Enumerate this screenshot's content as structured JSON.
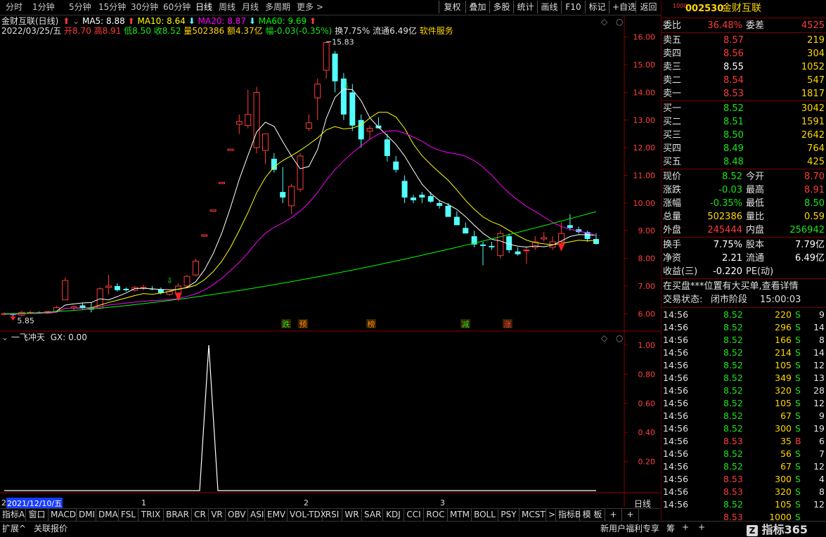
{
  "periods": [
    "分时",
    "1分钟",
    "5分钟",
    "15分钟",
    "30分钟",
    "60分钟",
    "日线",
    "周线",
    "月线",
    "多周期",
    "更多 >"
  ],
  "active_period": "日线",
  "toolbar": [
    "复权",
    "叠加",
    "多股",
    "统计",
    "画线",
    "F10",
    "标记",
    "+自选",
    "返回"
  ],
  "chart": {
    "name": "金财互联(日线)",
    "ma_legend": [
      {
        "label": "MA5: 8.88",
        "color": "#ffffff"
      },
      {
        "label": "MA10: 8.64",
        "color": "#ffff00"
      },
      {
        "label": "MA20: 8.87",
        "color": "#ff00ff"
      },
      {
        "label": "MA60: 9.69",
        "color": "#00ff00"
      }
    ],
    "info": {
      "date": "2022/03/25/五",
      "open": "开8.70",
      "high": "高8.91",
      "low": "低8.50",
      "close": "收8.52",
      "vol": "量502386",
      "amount": "额4.37亿",
      "change": "幅-0.03(-0.35%)",
      "turnover": "换7.75%",
      "float": "流通6.49亿",
      "sector": "软件服务"
    },
    "yticks": [
      "16.00",
      "15.00",
      "14.00",
      "13.00",
      "12.00",
      "11.00",
      "10.00",
      "9.00",
      "8.00",
      "7.00",
      "6.00"
    ],
    "high_label": "15.83",
    "low_label": "5.85",
    "markers": [
      {
        "text": "跌",
        "color": "#19e619"
      },
      {
        "text": "预",
        "color": "#ff8c00"
      },
      {
        "text": "榜",
        "color": "#ff8c00"
      },
      {
        "text": "减",
        "color": "#19e619"
      },
      {
        "text": "涨",
        "color": "#ff3b3b"
      }
    ],
    "indicator_name": "一飞冲天",
    "indicator_value": "GX: 0.00",
    "ind_ticks": [
      "1.00",
      "0.80",
      "0.60",
      "0.40",
      "0.20"
    ],
    "xaxis": {
      "date": "2021/12/10/五",
      "m1": "1",
      "m2": "2",
      "m3": "3",
      "period": "日线",
      "lead": "2"
    }
  },
  "chart_data": {
    "type": "candlestick",
    "price_axis": [
      5.5,
      16.5
    ],
    "candles": [
      [
        6.0,
        6.05,
        5.95,
        6.0
      ],
      [
        6.0,
        6.02,
        5.85,
        5.95
      ],
      [
        5.95,
        6.1,
        5.9,
        6.05
      ],
      [
        6.05,
        6.1,
        6.0,
        6.05
      ],
      [
        6.05,
        6.08,
        6.0,
        6.02
      ],
      [
        6.02,
        6.1,
        6.0,
        6.08
      ],
      [
        6.08,
        6.3,
        6.05,
        6.22
      ],
      [
        6.5,
        7.3,
        6.5,
        7.2
      ],
      [
        6.2,
        6.3,
        6.1,
        6.25
      ],
      [
        6.3,
        6.4,
        6.15,
        6.2
      ],
      [
        6.2,
        6.4,
        6.05,
        6.15
      ],
      [
        6.2,
        6.95,
        6.15,
        6.9
      ],
      [
        6.95,
        7.4,
        6.7,
        7.0
      ],
      [
        7.0,
        7.1,
        6.8,
        6.85
      ],
      [
        6.9,
        6.95,
        6.8,
        6.85
      ],
      [
        6.85,
        7.0,
        6.8,
        6.95
      ],
      [
        6.95,
        7.05,
        6.85,
        6.95
      ],
      [
        6.9,
        7.0,
        6.85,
        6.88
      ],
      [
        6.88,
        6.95,
        6.7,
        6.75
      ],
      [
        6.7,
        6.85,
        6.65,
        6.8
      ],
      [
        6.75,
        7.1,
        6.7,
        7.0
      ],
      [
        7.0,
        7.4,
        6.95,
        7.35
      ],
      [
        7.4,
        8.0,
        7.35,
        7.9
      ],
      [
        8.8,
        8.85,
        8.8,
        8.85
      ],
      [
        9.7,
        9.75,
        9.7,
        9.75
      ],
      [
        10.7,
        10.75,
        10.7,
        10.75
      ],
      [
        11.9,
        11.95,
        11.9,
        11.95
      ],
      [
        12.85,
        13.2,
        12.5,
        12.95
      ],
      [
        12.8,
        14.1,
        12.7,
        13.2
      ],
      [
        12.0,
        14.2,
        11.8,
        14.0
      ],
      [
        11.9,
        12.5,
        11.4,
        12.5
      ],
      [
        11.6,
        11.8,
        11.1,
        11.2
      ],
      [
        10.4,
        11.3,
        10.0,
        10.2
      ],
      [
        9.9,
        10.7,
        9.6,
        10.6
      ],
      [
        10.5,
        11.8,
        10.4,
        11.7
      ],
      [
        12.7,
        13.2,
        12.6,
        12.9
      ],
      [
        13.8,
        14.5,
        13.0,
        14.3
      ],
      [
        14.8,
        15.83,
        14.5,
        15.8
      ],
      [
        15.4,
        15.5,
        14.0,
        14.4
      ],
      [
        14.5,
        14.7,
        13.0,
        13.2
      ],
      [
        14.0,
        14.3,
        12.6,
        12.8
      ],
      [
        13.0,
        13.2,
        12.0,
        12.3
      ],
      [
        12.6,
        12.8,
        12.3,
        12.7
      ],
      [
        12.8,
        13.1,
        12.7,
        12.7
      ],
      [
        12.3,
        12.5,
        11.5,
        11.7
      ],
      [
        11.5,
        11.7,
        11.1,
        11.2
      ],
      [
        10.8,
        11.0,
        10.0,
        10.2
      ],
      [
        10.2,
        10.3,
        10.0,
        10.1
      ],
      [
        10.3,
        10.4,
        10.0,
        10.2
      ],
      [
        10.25,
        10.4,
        10.0,
        10.05
      ],
      [
        10.0,
        10.1,
        9.8,
        9.9
      ],
      [
        9.9,
        10.0,
        9.6,
        9.5
      ],
      [
        9.5,
        9.7,
        9.2,
        9.2
      ],
      [
        9.1,
        9.3,
        8.9,
        8.9
      ],
      [
        8.8,
        9.0,
        8.4,
        8.5
      ],
      [
        8.5,
        8.6,
        7.75,
        8.45
      ],
      [
        8.45,
        8.6,
        8.3,
        8.4
      ],
      [
        8.1,
        9.0,
        8.0,
        8.9
      ],
      [
        8.8,
        8.9,
        8.2,
        8.3
      ],
      [
        8.25,
        8.4,
        8.1,
        8.15
      ],
      [
        8.3,
        8.4,
        7.8,
        8.3
      ],
      [
        8.4,
        8.8,
        8.3,
        8.6
      ],
      [
        8.7,
        8.95,
        8.6,
        8.75
      ],
      [
        8.4,
        8.8,
        8.3,
        8.6
      ],
      [
        8.6,
        9.3,
        8.5,
        8.9
      ],
      [
        9.2,
        9.6,
        9.0,
        9.1
      ],
      [
        9.05,
        9.15,
        8.9,
        8.95
      ],
      [
        8.95,
        9.0,
        8.6,
        8.7
      ],
      [
        8.7,
        8.91,
        8.5,
        8.52
      ]
    ],
    "signal_index": 20
  },
  "right": {
    "code": "002530",
    "stock_name": "金财互联",
    "weibi": {
      "label": "委比",
      "value": "36.48%",
      "label2": "委差",
      "value2": "4525"
    },
    "asks": [
      {
        "label": "卖五",
        "price": "8.57",
        "vol": "219"
      },
      {
        "label": "卖四",
        "price": "8.56",
        "vol": "304"
      },
      {
        "label": "卖三",
        "price": "8.55",
        "vol": "1052"
      },
      {
        "label": "卖二",
        "price": "8.54",
        "vol": "547"
      },
      {
        "label": "卖一",
        "price": "8.53",
        "vol": "1817"
      }
    ],
    "bids": [
      {
        "label": "买一",
        "price": "8.52",
        "vol": "3042"
      },
      {
        "label": "买二",
        "price": "8.51",
        "vol": "1591"
      },
      {
        "label": "买三",
        "price": "8.50",
        "vol": "2642"
      },
      {
        "label": "买四",
        "price": "8.49",
        "vol": "764"
      },
      {
        "label": "买五",
        "price": "8.48",
        "vol": "425"
      }
    ],
    "quote": [
      {
        "l1": "现价",
        "v1": "8.52",
        "c1": "green",
        "l2": "今开",
        "v2": "8.70",
        "c2": "red"
      },
      {
        "l1": "涨跌",
        "v1": "-0.03",
        "c1": "green",
        "l2": "最高",
        "v2": "8.91",
        "c2": "red"
      },
      {
        "l1": "涨幅",
        "v1": "-0.35%",
        "c1": "green",
        "l2": "最低",
        "v2": "8.50",
        "c2": "green"
      },
      {
        "l1": "总量",
        "v1": "502386",
        "c1": "yellow",
        "l2": "量比",
        "v2": "0.59",
        "c2": "yellow"
      },
      {
        "l1": "外盘",
        "v1": "245444",
        "c1": "red",
        "l2": "内盘",
        "v2": "256942",
        "c2": "green"
      }
    ],
    "quote2": [
      {
        "l1": "换手",
        "v1": "7.75%",
        "l2": "股本",
        "v2": "7.79亿"
      },
      {
        "l1": "净资",
        "v1": "2.21",
        "l2": "流通",
        "v2": "6.49亿"
      },
      {
        "l1": "收益(三)",
        "v1": "-0.220",
        "l2": "PE(动)",
        "v2": ""
      }
    ],
    "notice": "在买盘***位置有大买单,查看详情",
    "status_label": "交易状态:",
    "status_value": "闭市阶段",
    "status_time": "15:00:03",
    "ticks": [
      {
        "t": "14:56",
        "p": "8.52",
        "v": "220",
        "s": "S",
        "n": "9"
      },
      {
        "t": "14:56",
        "p": "8.52",
        "v": "296",
        "s": "S",
        "n": "14"
      },
      {
        "t": "14:56",
        "p": "8.52",
        "v": "166",
        "s": "S",
        "n": "8"
      },
      {
        "t": "14:56",
        "p": "8.52",
        "v": "214",
        "s": "S",
        "n": "14"
      },
      {
        "t": "14:56",
        "p": "8.52",
        "v": "105",
        "s": "S",
        "n": "12"
      },
      {
        "t": "14:56",
        "p": "8.52",
        "v": "349",
        "s": "S",
        "n": "13"
      },
      {
        "t": "14:56",
        "p": "8.52",
        "v": "320",
        "s": "S",
        "n": "28"
      },
      {
        "t": "14:56",
        "p": "8.52",
        "v": "105",
        "s": "S",
        "n": "12"
      },
      {
        "t": "14:56",
        "p": "8.52",
        "v": "67",
        "s": "S",
        "n": "9"
      },
      {
        "t": "14:56",
        "p": "8.52",
        "v": "300",
        "s": "S",
        "n": "19"
      },
      {
        "t": "14:56",
        "p": "8.53",
        "v": "35",
        "s": "B",
        "n": "6"
      },
      {
        "t": "14:56",
        "p": "8.52",
        "v": "56",
        "s": "S",
        "n": "7"
      },
      {
        "t": "14:56",
        "p": "8.52",
        "v": "67",
        "s": "S",
        "n": "12"
      },
      {
        "t": "14:56",
        "p": "8.53",
        "v": "300",
        "s": "S",
        "n": "4"
      },
      {
        "t": "14:56",
        "p": "8.53",
        "v": "320",
        "s": "S",
        "n": "8"
      },
      {
        "t": "14:56",
        "p": "8.52",
        "v": "105",
        "s": "S",
        "n": "12"
      },
      {
        "t": "",
        "p": "8.53",
        "v": "1000",
        "s": "S",
        "n": ""
      }
    ]
  },
  "tabs": [
    "指标A",
    "窗口",
    "MACD",
    "DMI",
    "DMA",
    "FSL",
    "TRIX",
    "BRAR",
    "CR",
    "VR",
    "OBV",
    "ASI",
    "EMV",
    "VOL-TDX",
    "RSI",
    "WR",
    "SAR",
    "KDJ",
    "CCI",
    "ROC",
    "MTM",
    "BOLL",
    "PSY",
    "MCST",
    ">",
    "指标B",
    "模 板",
    "+",
    "+"
  ],
  "status": {
    "left1": "扩展^",
    "left2": "关联报价",
    "promo": "新用户福利专享",
    "s1": "筹",
    "watermark": "指标365"
  }
}
